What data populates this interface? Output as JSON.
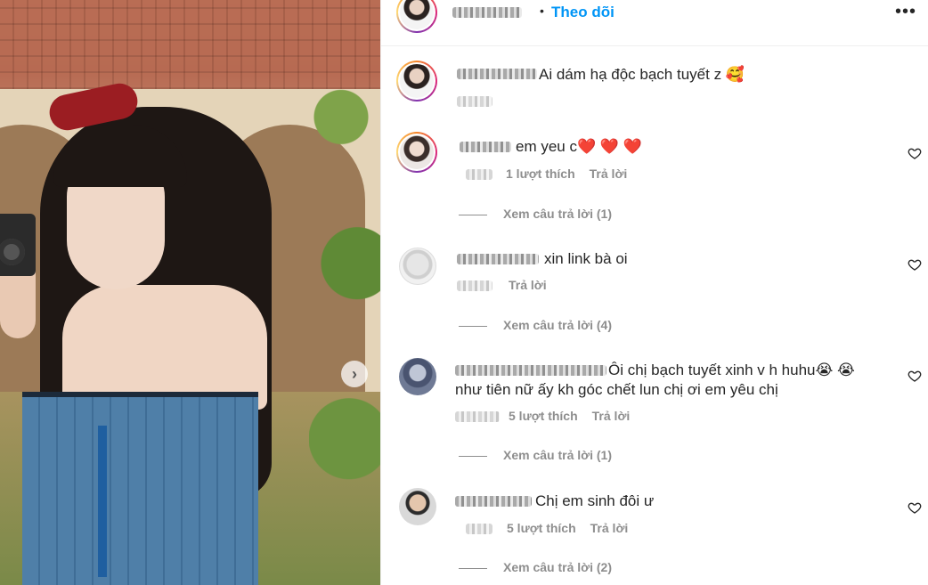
{
  "post_image": {
    "next_icon": "chevron-right-icon"
  },
  "header": {
    "follow_label": "Theo dõi",
    "separator": "•",
    "more_icon": "•••"
  },
  "caption": {
    "text": "Ai dám hạ độc bạch tuyết z 🥰"
  },
  "comments": [
    {
      "text": "em yeu c❤️ ❤️ ❤️",
      "likes": "1 lượt thích",
      "reply": "Trả lời",
      "view_replies": "Xem câu trả lời (1)"
    },
    {
      "text": "xin link   bà oi",
      "likes": "",
      "reply": "Trả lời",
      "view_replies": "Xem câu trả lời (4)"
    },
    {
      "text": "Ôi chị bạch tuyết xinh v  h huhu😭 😭",
      "text2": "như tiên nữ ấy kh góc chết lun chị ơi em yêu chị",
      "likes": "5 lượt thích",
      "reply": "Trả lời",
      "view_replies": "Xem câu trả lời (1)"
    },
    {
      "text": "Chị em sinh đôi ư",
      "likes": "5 lượt thích",
      "reply": "Trả lời",
      "view_replies": "Xem câu trả lời (2)"
    }
  ]
}
